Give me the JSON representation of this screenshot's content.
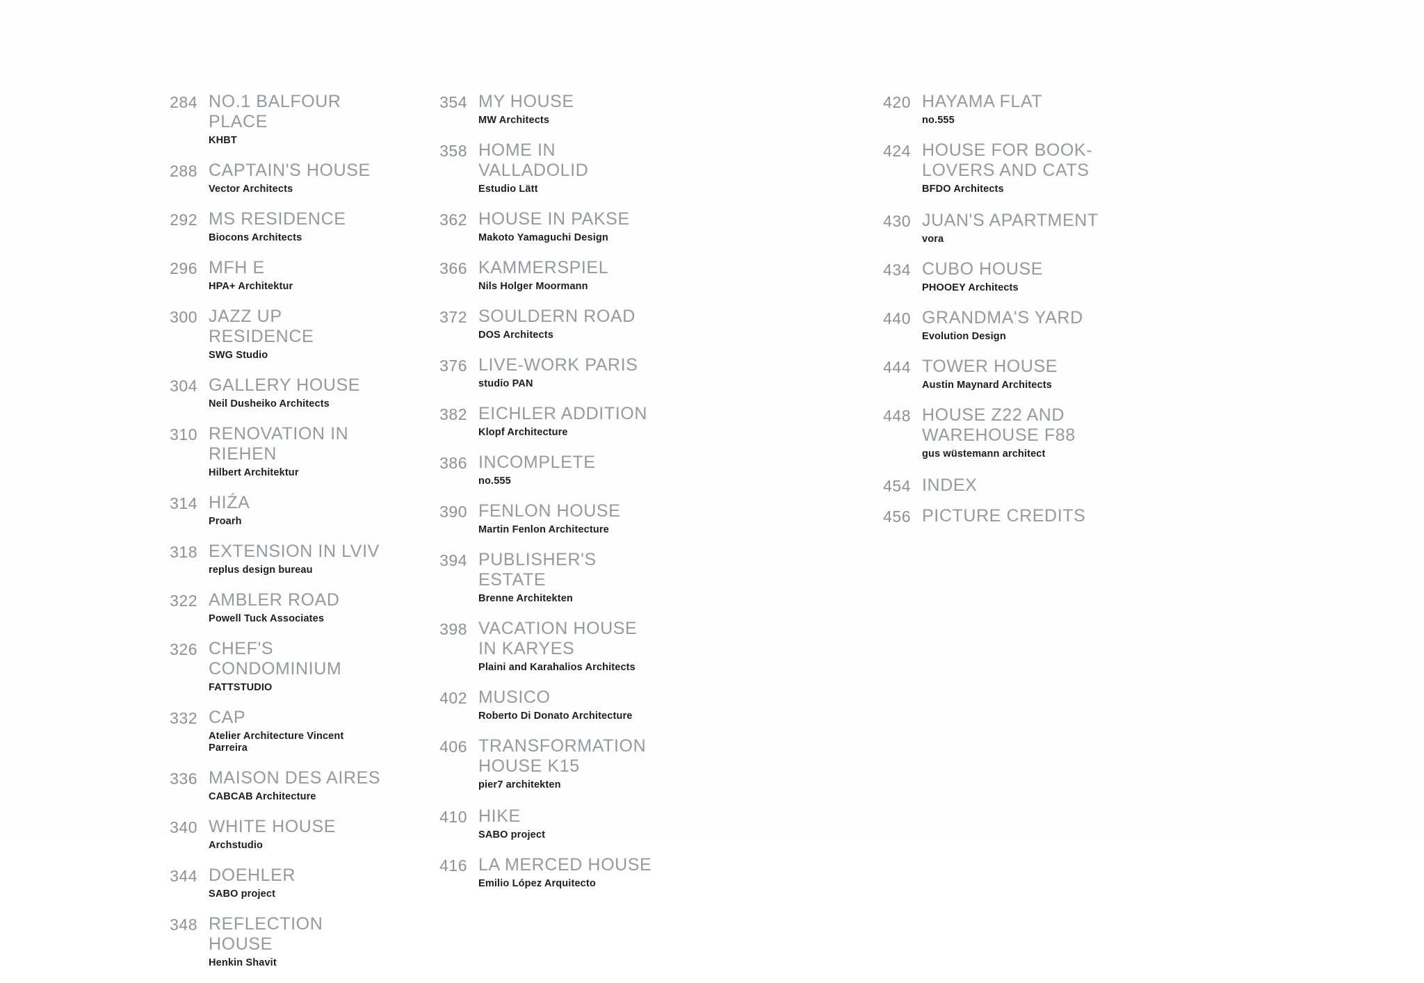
{
  "document": {
    "type": "table-of-contents",
    "background_color": "#fefefe",
    "number_color": "#8e9096",
    "title_color": "#97999f",
    "architect_color": "#1d1d1f"
  },
  "columns": [
    {
      "name": "column-1",
      "entries": [
        {
          "page": "284",
          "title": "NO.1 BALFOUR PLACE",
          "architect": "KHBT"
        },
        {
          "page": "288",
          "title": "CAPTAIN'S HOUSE",
          "architect": "Vector Architects"
        },
        {
          "page": "292",
          "title": "MS RESIDENCE",
          "architect": "Biocons Architects"
        },
        {
          "page": "296",
          "title": "MFH E",
          "architect": "HPA+ Architektur"
        },
        {
          "page": "300",
          "title": "JAZZ UP RESIDENCE",
          "architect": "SWG Studio"
        },
        {
          "page": "304",
          "title": "GALLERY HOUSE",
          "architect": "Neil Dusheiko Architects"
        },
        {
          "page": "310",
          "title": "RENOVATION IN RIEHEN",
          "architect": "Hilbert Architektur"
        },
        {
          "page": "314",
          "title": "HIŹA",
          "architect": "Proarh"
        },
        {
          "page": "318",
          "title": "EXTENSION IN LVIV",
          "architect": "replus design bureau"
        },
        {
          "page": "322",
          "title": "AMBLER ROAD",
          "architect": "Powell Tuck Associates"
        },
        {
          "page": "326",
          "title": "CHEF'S CONDOMINIUM",
          "architect": "FATTSTUDIO"
        },
        {
          "page": "332",
          "title": "CAP",
          "architect": "Atelier Architecture Vincent Parreira"
        },
        {
          "page": "336",
          "title": "MAISON DES AIRES",
          "architect": "CABCAB Architecture"
        },
        {
          "page": "340",
          "title": "WHITE HOUSE",
          "architect": "Archstudio"
        },
        {
          "page": "344",
          "title": "DOEHLER",
          "architect": "SABO project"
        },
        {
          "page": "348",
          "title": "REFLECTION HOUSE",
          "architect": "Henkin Shavit"
        }
      ]
    },
    {
      "name": "column-2",
      "entries": [
        {
          "page": "354",
          "title": "MY HOUSE",
          "architect": "MW Architects"
        },
        {
          "page": "358",
          "title": "HOME IN VALLADOLID",
          "architect": "Estudio Lätt"
        },
        {
          "page": "362",
          "title": "HOUSE IN PAKSE",
          "architect": "Makoto Yamaguchi Design"
        },
        {
          "page": "366",
          "title": "KAMMERSPIEL",
          "architect": "Nils Holger Moormann"
        },
        {
          "page": "372",
          "title": "SOULDERN ROAD",
          "architect": "DOS Architects"
        },
        {
          "page": "376",
          "title": "LIVE-WORK PARIS",
          "architect": "studio PAN"
        },
        {
          "page": "382",
          "title": "EICHLER ADDITION",
          "architect": "Klopf Architecture"
        },
        {
          "page": "386",
          "title": "INCOMPLETE",
          "architect": "no.555"
        },
        {
          "page": "390",
          "title": "FENLON HOUSE",
          "architect": "Martin Fenlon Architecture"
        },
        {
          "page": "394",
          "title": "PUBLISHER'S ESTATE",
          "architect": "Brenne Architekten"
        },
        {
          "page": "398",
          "title": "VACATION HOUSE IN KARYES",
          "architect": "Plaini and Karahalios Architects"
        },
        {
          "page": "402",
          "title": "MUSICO",
          "architect": "Roberto Di Donato Architecture"
        },
        {
          "page": "406",
          "title": "TRANSFORMATION\nHOUSE K15",
          "architect": "pier7 architekten",
          "two_line": true
        },
        {
          "page": "410",
          "title": "HIKE",
          "architect": "SABO project"
        },
        {
          "page": "416",
          "title": "LA MERCED HOUSE",
          "architect": "Emilio López Arquitecto"
        }
      ]
    },
    {
      "name": "column-3",
      "entries": [
        {
          "page": "420",
          "title": "HAYAMA FLAT",
          "architect": "no.555"
        },
        {
          "page": "424",
          "title": "HOUSE FOR BOOK-\nLOVERS AND CATS",
          "architect": "BFDO Architects",
          "two_line": true
        },
        {
          "page": "430",
          "title": "JUAN'S APARTMENT",
          "architect": "vora"
        },
        {
          "page": "434",
          "title": "CUBO HOUSE",
          "architect": "PHOOEY Architects"
        },
        {
          "page": "440",
          "title": "GRANDMA'S YARD",
          "architect": "Evolution Design"
        },
        {
          "page": "444",
          "title": "TOWER HOUSE",
          "architect": "Austin Maynard Architects"
        },
        {
          "page": "448",
          "title": "HOUSE Z22 AND\nWAREHOUSE F88",
          "architect": "gus wüstemann architect",
          "two_line": true
        },
        {
          "page": "454",
          "title": "INDEX",
          "architect": ""
        },
        {
          "page": "456",
          "title": "PICTURE CREDITS",
          "architect": ""
        }
      ]
    }
  ]
}
